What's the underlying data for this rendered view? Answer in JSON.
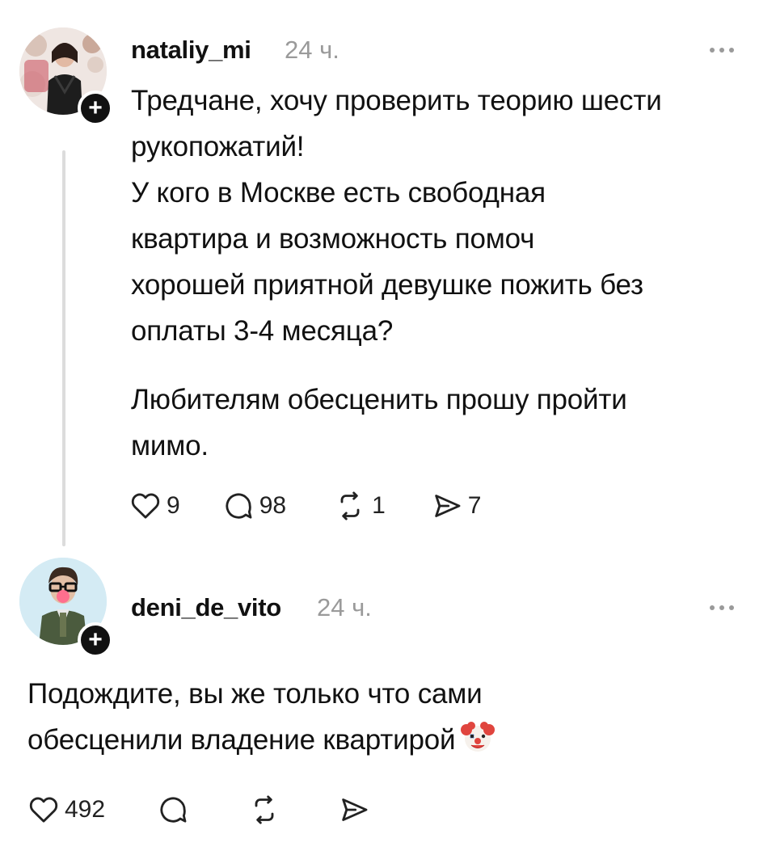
{
  "posts": [
    {
      "username": "nataliy_mi",
      "time": "24 ч.",
      "avatar_icon": "avatar-photo-woman",
      "follow_icon": "plus-icon",
      "follow_symbol": "+",
      "text_lines": [
        "Тредчане, хочу проверить теорию шести",
        "рукопожатий!",
        "У кого в Москве есть свободная",
        "квартира и возможность помоч",
        "хорошей приятной девушке пожить без",
        "оплаты 3-4 месяца?"
      ],
      "text_lines_2": [
        "Любителям обесценить прошу пройти",
        "мимо."
      ],
      "likes": "9",
      "replies": "98",
      "reposts": "1",
      "shares": "7"
    },
    {
      "username": "deni_de_vito",
      "time": "24 ч.",
      "avatar_icon": "avatar-photo-man-clown-nose",
      "follow_icon": "plus-icon",
      "follow_symbol": "+",
      "text_lines": [
        "Подождите, вы же только что сами",
        "обесценили владение квартирой"
      ],
      "emoji": "clown-face-emoji",
      "likes": "492"
    }
  ],
  "colors": {
    "text": "#111111",
    "muted": "#9a9a9a",
    "thread_line": "#dcdcdc",
    "badge": "#111111"
  }
}
